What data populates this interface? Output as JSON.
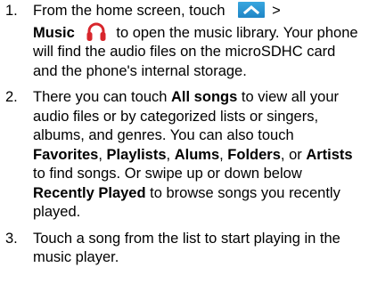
{
  "steps": [
    {
      "number": "1.",
      "line1_pre": "From the home screen, touch",
      "line1_post": ">",
      "music": "Music",
      "line2_post": "to open the music library. Your phone will find the audio files on the microSDHC card and the phone's internal storage.",
      "icons": [
        "apps-chevron-icon",
        "headphones-icon"
      ]
    },
    {
      "number": "2.",
      "t1": "There you can touch ",
      "b1": "All songs",
      "t2": " to view all your audio files or by categorized lists or singers, albums, and genres. You can also touch ",
      "b2": "Favorites",
      "t3": ", ",
      "b3": "Playlists",
      "t4": ", ",
      "b4": "Alums",
      "t5": ", ",
      "b5": "Folders",
      "t6": ", or ",
      "b6": "Artists",
      "t7": " to find songs. Or swipe up or down below ",
      "b7": "Recently Played",
      "t8": " to browse songs you recently played."
    },
    {
      "number": "3.",
      "text": "Touch a song from the list to start playing in the music player."
    }
  ],
  "colors": {
    "text": "#000000",
    "apps_icon_blue": "#2a96d6",
    "headphones_red": "#d8262c"
  }
}
